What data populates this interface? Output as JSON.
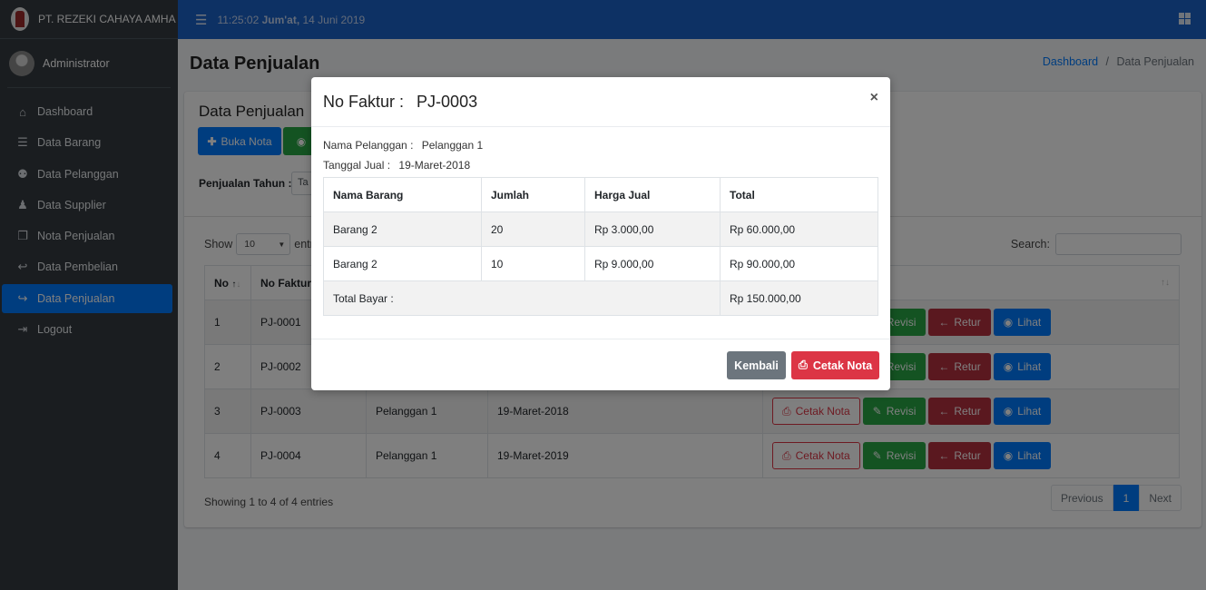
{
  "brand": {
    "name": "PT. REZEKI CAHAYA AMHA"
  },
  "user": {
    "name": "Administrator"
  },
  "topbar": {
    "time": "11:25:02",
    "day": "Jum'at,",
    "date": "14 Juni 2019"
  },
  "sidebar": {
    "items": [
      {
        "label": "Dashboard",
        "icon": "home-icon",
        "glyph": "⌂"
      },
      {
        "label": "Data Barang",
        "icon": "list-icon",
        "glyph": "☰"
      },
      {
        "label": "Data Pelanggan",
        "icon": "users-icon",
        "glyph": "⚉"
      },
      {
        "label": "Data Supplier",
        "icon": "user-icon",
        "glyph": "♟"
      },
      {
        "label": "Nota Penjualan",
        "icon": "copy-icon",
        "glyph": "❐"
      },
      {
        "label": "Data Pembelian",
        "icon": "reply-icon",
        "glyph": "↩"
      },
      {
        "label": "Data Penjualan",
        "icon": "share-icon",
        "glyph": "↪",
        "active": true
      },
      {
        "label": "Logout",
        "icon": "sign-out-icon",
        "glyph": "⇥"
      }
    ]
  },
  "page": {
    "title": "Data Penjualan",
    "breadcrumb_home": "Dashboard",
    "breadcrumb_sep": "/",
    "breadcrumb_current": "Data Penjualan"
  },
  "card": {
    "title": "Data Penjualan",
    "buka_nota": "Buka Nota",
    "filter_label": "Penjualan Tahun :",
    "filter_value": "Ta"
  },
  "datatable": {
    "show_label": "Show",
    "length_value": "10",
    "entries_label": "entr",
    "search_label": "Search:",
    "headers": [
      "No",
      "No Faktur"
    ],
    "rows": [
      {
        "no": "1",
        "faktur": "PJ-0001",
        "pelanggan": "",
        "tanggal": ""
      },
      {
        "no": "2",
        "faktur": "PJ-0002",
        "pelanggan": "",
        "tanggal": ""
      },
      {
        "no": "3",
        "faktur": "PJ-0003",
        "pelanggan": "Pelanggan 1",
        "tanggal": "19-Maret-2018"
      },
      {
        "no": "4",
        "faktur": "PJ-0004",
        "pelanggan": "Pelanggan 1",
        "tanggal": "19-Maret-2019"
      }
    ],
    "actions": {
      "cetak": "Cetak Nota",
      "revisi": "Revisi",
      "retur": "Retur",
      "lihat": "Lihat"
    },
    "info": "Showing 1 to 4 of 4 entries",
    "pager": {
      "previous": "Previous",
      "page": "1",
      "next": "Next"
    }
  },
  "modal": {
    "title_label": "No Faktur :",
    "title_value": "PJ-0003",
    "close": "×",
    "pelanggan_label": "Nama Pelanggan :",
    "pelanggan_value": "Pelanggan 1",
    "tanggal_label": "Tanggal Jual :",
    "tanggal_value": "19-Maret-2018",
    "headers": [
      "Nama Barang",
      "Jumlah",
      "Harga Jual",
      "Total"
    ],
    "items": [
      {
        "nama": "Barang 2",
        "jumlah": "20",
        "harga": "Rp 3.000,00",
        "total": "Rp 60.000,00"
      },
      {
        "nama": "Barang 2",
        "jumlah": "10",
        "harga": "Rp 9.000,00",
        "total": "Rp 90.000,00"
      }
    ],
    "total_label": "Total Bayar :",
    "total_value": "Rp 150.000,00",
    "btn_kembali": "Kembali",
    "btn_cetak": "Cetak Nota"
  }
}
